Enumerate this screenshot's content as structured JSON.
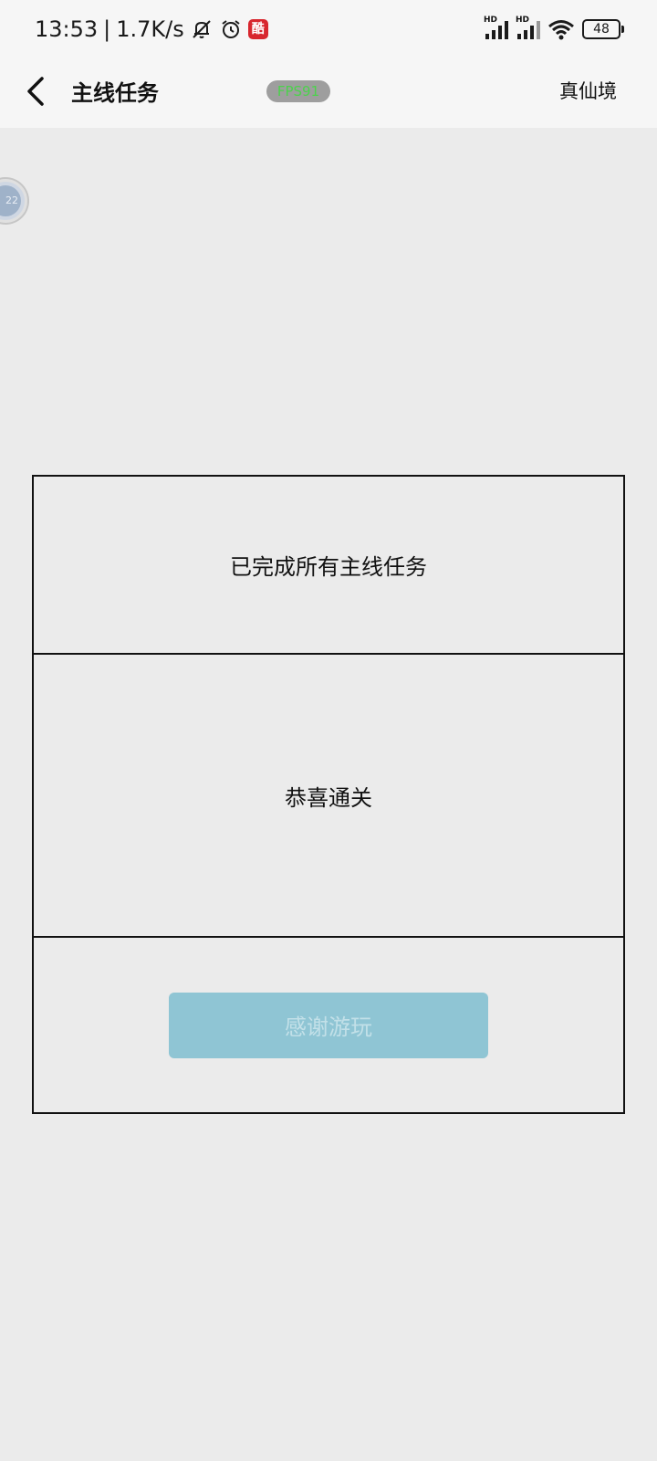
{
  "status_bar": {
    "time": "13:53",
    "separator": "|",
    "speed": "1.7K/s",
    "app_badge_text": "酷",
    "signal_1_label": "HD",
    "signal_2_label": "HD",
    "battery": "48",
    "icons": [
      "mute-bell-icon",
      "alarm-icon",
      "app-icon",
      "signal-icon",
      "signal-icon",
      "wifi-icon",
      "battery-icon"
    ]
  },
  "nav": {
    "title": "主线任务",
    "fps": "FPS91",
    "realm": "真仙境",
    "back_icon": "chevron-left-icon"
  },
  "float_bubble": {
    "text": "22"
  },
  "panel": {
    "message": "已完成所有主线任务",
    "congrats": "恭喜通关",
    "button_label": "感谢游玩"
  },
  "colors": {
    "background": "#ebebeb",
    "bar_background": "#f6f6f6",
    "button": "#8fc5d4",
    "button_text": "#c2e0e8",
    "fps_badge": "#9e9e9e",
    "fps_text": "#4cd24c",
    "app_badge": "#d8262e"
  }
}
